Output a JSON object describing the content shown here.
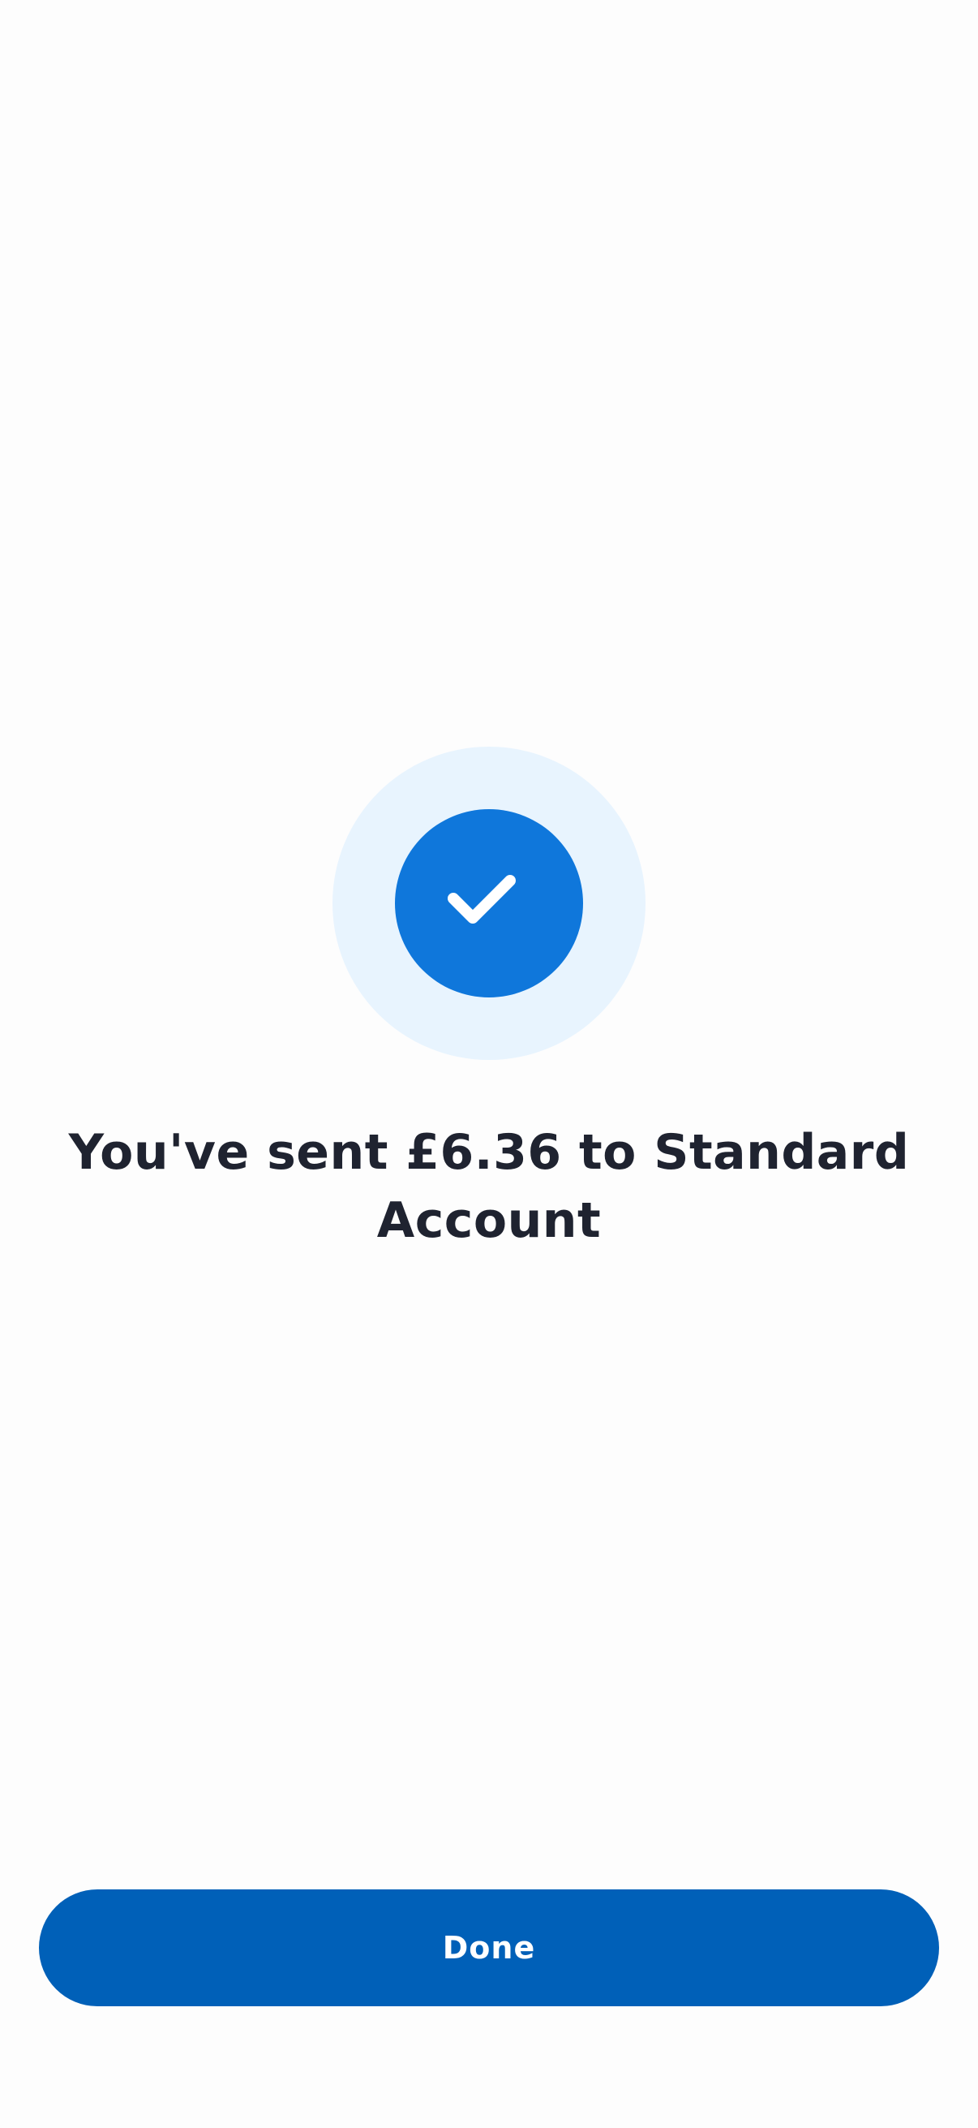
{
  "confirmation": {
    "icon": "check-icon",
    "message": "You've sent £6.36 to Standard Account"
  },
  "actions": {
    "done_label": "Done"
  },
  "colors": {
    "background": "#fdfdfd",
    "halo": "#e8f4fe",
    "accent_circle": "#0f77db",
    "check_mark": "#ffffff",
    "button": "#0060b8",
    "button_text": "#ffffff",
    "text": "#1f2330"
  }
}
